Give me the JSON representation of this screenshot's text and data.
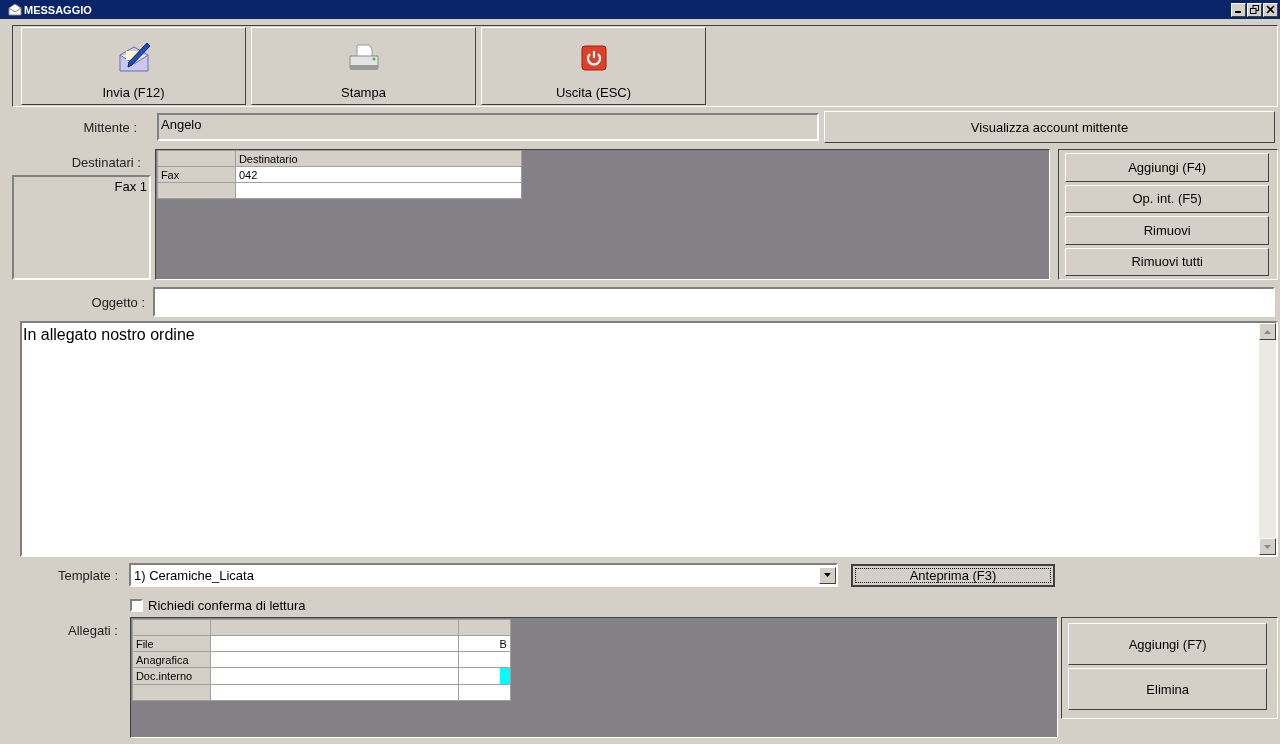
{
  "window": {
    "title": "MESSAGGIO"
  },
  "toolbar": [
    {
      "label": "Invia (F12)",
      "kind": "send"
    },
    {
      "label": "Stampa",
      "kind": "print"
    },
    {
      "label": "Uscita (ESC)",
      "kind": "exit"
    }
  ],
  "sender": {
    "label": "Mittente :",
    "value": "Angelo",
    "button": "Visualizza account mittente"
  },
  "recipients": {
    "label": "Destinatari :",
    "side_text": "Fax 1",
    "columns": [
      "Destinatario"
    ],
    "rows": [
      {
        "type": "Fax",
        "value": "042"
      }
    ],
    "buttons": [
      "Aggiungi (F4)",
      "Op. int. (F5)",
      "Rimuovi",
      "Rimuovi tutti"
    ]
  },
  "subject": {
    "label": "Oggetto :"
  },
  "body": {
    "value": "In allegato nostro ordine"
  },
  "template": {
    "label": "Template :",
    "value": "1) Ceramiche_Licata",
    "button": "Anteprima (F3)"
  },
  "read_receipt": {
    "label": "Richiedi conferma di lettura",
    "checked": false
  },
  "attachments": {
    "label": "Allegati :",
    "rows": [
      {
        "type": "File",
        "column_3": "B"
      },
      {
        "type": "Anagrafica"
      },
      {
        "type": "Doc.interno",
        "color": "#00ffff"
      }
    ],
    "buttons": [
      "Aggiungi (F7)",
      "Elimina"
    ]
  }
}
